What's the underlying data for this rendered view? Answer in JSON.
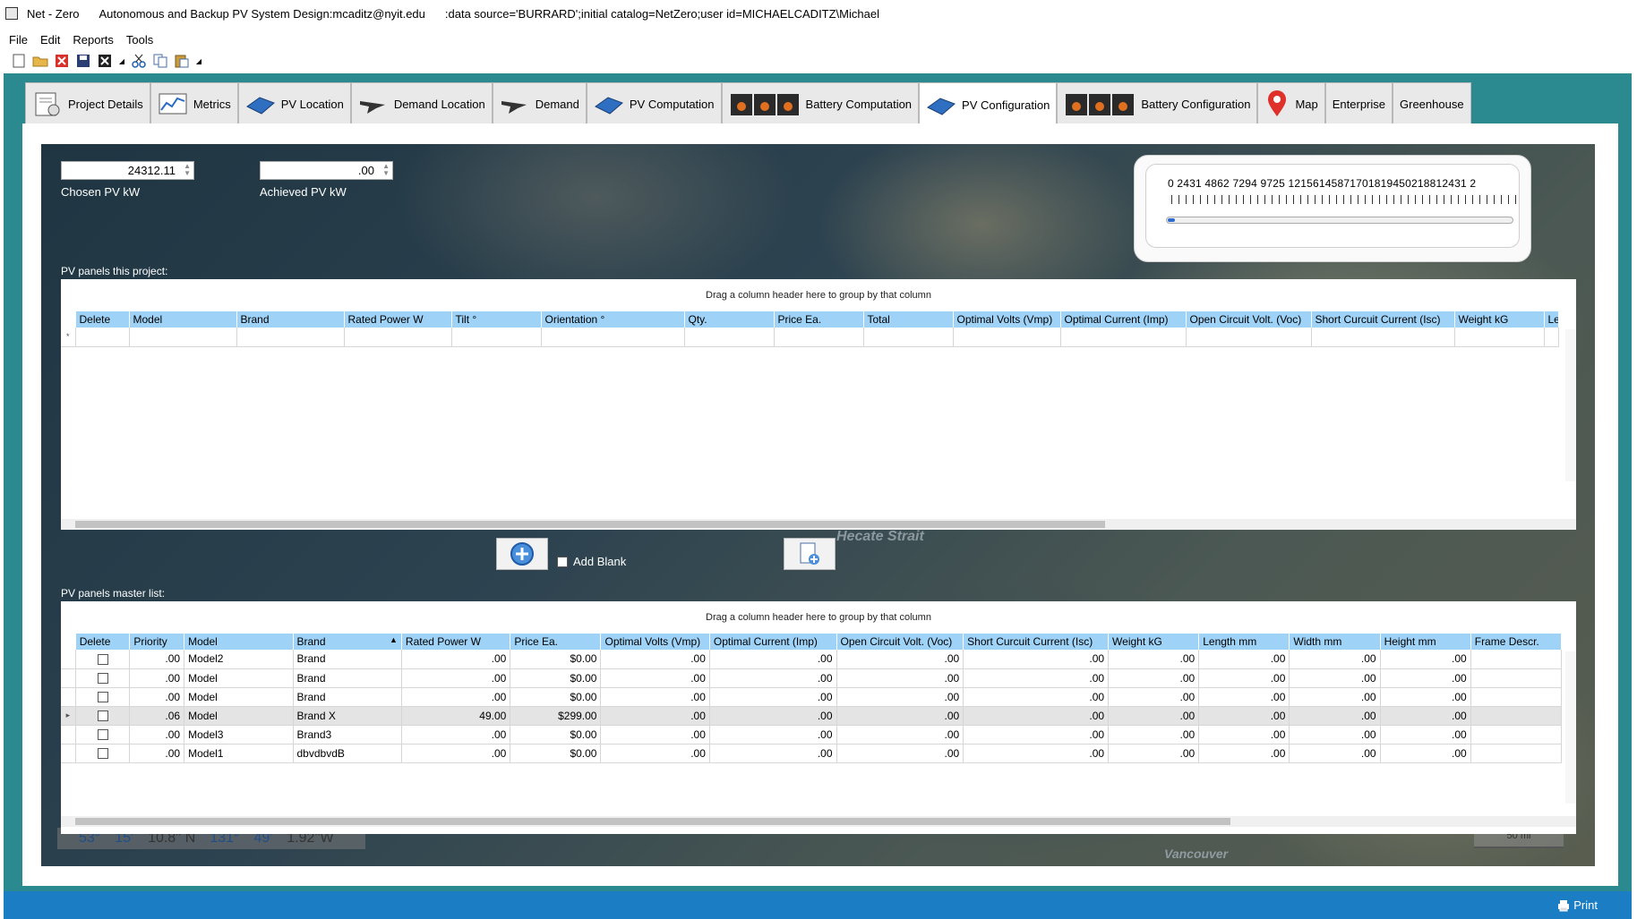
{
  "window": {
    "app_name": "Net - Zero",
    "subtitle": "Autonomous and Backup PV System Design:mcaditz@nyit.edu",
    "connection": ":data source='BURRARD';initial catalog=NetZero;user id=MICHAELCADITZ\\Michael"
  },
  "menu": [
    "File",
    "Edit",
    "Reports",
    "Tools"
  ],
  "toolbar_icons": [
    "new-file-icon",
    "open-folder-icon",
    "close-red-icon",
    "save-icon",
    "close-black-icon",
    "cut-icon",
    "copy-icon",
    "paste-icon"
  ],
  "tabs": [
    {
      "label": "Project Details",
      "icon": "settings-doc-icon",
      "active": false
    },
    {
      "label": "Metrics",
      "icon": "chart-icon",
      "active": false
    },
    {
      "label": "PV Location",
      "icon": "solar-panel-icon",
      "active": false
    },
    {
      "label": "Demand Location",
      "icon": "plane-icon",
      "active": false
    },
    {
      "label": "Demand",
      "icon": "plane-icon",
      "active": false
    },
    {
      "label": "PV Computation",
      "icon": "solar-panel-icon",
      "active": false
    },
    {
      "label": "Battery Computation",
      "icon": "battery-icon",
      "active": false
    },
    {
      "label": "PV Configuration",
      "icon": "solar-panel-icon",
      "active": true
    },
    {
      "label": "Battery Configuration",
      "icon": "battery-icon",
      "active": false
    },
    {
      "label": "Map",
      "icon": "map-pin-icon",
      "active": false
    },
    {
      "label": "Enterprise",
      "icon": "",
      "active": false
    },
    {
      "label": "Greenhouse",
      "icon": "",
      "active": false
    }
  ],
  "chosen_pv": {
    "value": "24312.11",
    "label": "Chosen PV kW"
  },
  "achieved_pv": {
    "value": ".00",
    "label": "Achieved PV kW"
  },
  "gauge": {
    "scale_text": "0    2431   4862   7294   9725  12156145871701819450218812431 2",
    "scale_labels": [
      "0",
      "2431",
      "4862",
      "7294",
      "9725",
      "12156",
      "14587",
      "17018",
      "19450",
      "21881",
      "24312"
    ],
    "value_fraction": 0.0
  },
  "map": {
    "label_strait": "Hecate Strait",
    "label_city": "Vancouver",
    "coord_parts": [
      "53°",
      "15'",
      "10.8''",
      "N",
      "131°",
      "49'",
      "1.92''",
      "W"
    ],
    "scale_text": "50 mi"
  },
  "project_grid": {
    "title": "PV panels this project:",
    "group_hint": "Drag a column header here to group by that column",
    "columns": [
      "Delete",
      "Model",
      "Brand",
      "Rated Power W",
      "Tilt °",
      "Orientation °",
      "Qty.",
      "Price Ea.",
      "Total",
      "Optimal Volts (Vmp)",
      "Optimal Current (Imp)",
      "Open Circuit Volt. (Voc)",
      "Short Curcuit Current (Isc)",
      "Weight kG",
      "Len"
    ],
    "new_row_marker": "*"
  },
  "buttons": {
    "add_label": "add-circle-icon",
    "add_blank_label": "Add Blank",
    "new_doc_label": "new-document-icon"
  },
  "master_grid": {
    "title": "PV panels master list:",
    "group_hint": "Drag a column header here to group by that column",
    "columns": [
      "Delete",
      "Priority",
      "Model",
      "Brand",
      "Rated Power W",
      "Price Ea.",
      "Optimal Volts (Vmp)",
      "Optimal Current (Imp)",
      "Open Circuit Volt. (Voc)",
      "Short Curcuit Current (Isc)",
      "Weight kG",
      "Length mm",
      "Width mm",
      "Height mm",
      "Frame Descr."
    ],
    "rows": [
      {
        "priority": ".00",
        "model": "Model2",
        "brand": "Brand",
        "rated": ".00",
        "price": "$0.00",
        "vmp": ".00",
        "imp": ".00",
        "voc": ".00",
        "isc": ".00",
        "weight": ".00",
        "length": ".00",
        "width": ".00",
        "height": ".00",
        "frame": "",
        "selected": false
      },
      {
        "priority": ".00",
        "model": "Model",
        "brand": "Brand",
        "rated": ".00",
        "price": "$0.00",
        "vmp": ".00",
        "imp": ".00",
        "voc": ".00",
        "isc": ".00",
        "weight": ".00",
        "length": ".00",
        "width": ".00",
        "height": ".00",
        "frame": "",
        "selected": false
      },
      {
        "priority": ".00",
        "model": "Model",
        "brand": "Brand",
        "rated": ".00",
        "price": "$0.00",
        "vmp": ".00",
        "imp": ".00",
        "voc": ".00",
        "isc": ".00",
        "weight": ".00",
        "length": ".00",
        "width": ".00",
        "height": ".00",
        "frame": "",
        "selected": false
      },
      {
        "priority": ".06",
        "model": "Model",
        "brand": "Brand X",
        "rated": "49.00",
        "price": "$299.00",
        "vmp": ".00",
        "imp": ".00",
        "voc": ".00",
        "isc": ".00",
        "weight": ".00",
        "length": ".00",
        "width": ".00",
        "height": ".00",
        "frame": "",
        "selected": true
      },
      {
        "priority": ".00",
        "model": "Model3",
        "brand": "Brand3",
        "rated": ".00",
        "price": "$0.00",
        "vmp": ".00",
        "imp": ".00",
        "voc": ".00",
        "isc": ".00",
        "weight": ".00",
        "length": ".00",
        "width": ".00",
        "height": ".00",
        "frame": "",
        "selected": false
      },
      {
        "priority": ".00",
        "model": "Model1",
        "brand": "dbvdbvdB",
        "rated": ".00",
        "price": "$0.00",
        "vmp": ".00",
        "imp": ".00",
        "voc": ".00",
        "isc": ".00",
        "weight": ".00",
        "length": ".00",
        "width": ".00",
        "height": ".00",
        "frame": "",
        "selected": false
      }
    ]
  },
  "statusbar": {
    "print_label": "Print"
  },
  "colors": {
    "accent": "#1b7dc3",
    "header": "#9ed2f7",
    "workspace": "#2a8a8f"
  }
}
